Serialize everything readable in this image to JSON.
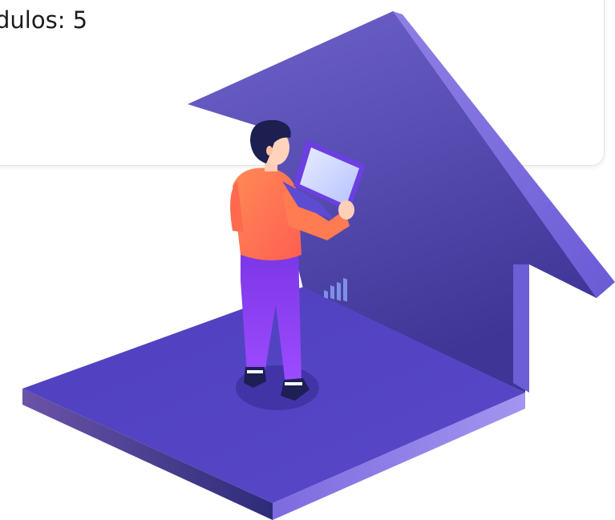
{
  "card": {
    "modules_text": "dulos: 5"
  },
  "illustration": {
    "icon": "person-with-laptop-upward-arrow",
    "colors": {
      "arrow_light": "#7d6ed8",
      "arrow_dark": "#433aa0",
      "floor_top": "#5a4bc6",
      "shirt": "#ff7a4d",
      "pants": "#8a3cf0",
      "hair": "#1b1f4b"
    }
  }
}
